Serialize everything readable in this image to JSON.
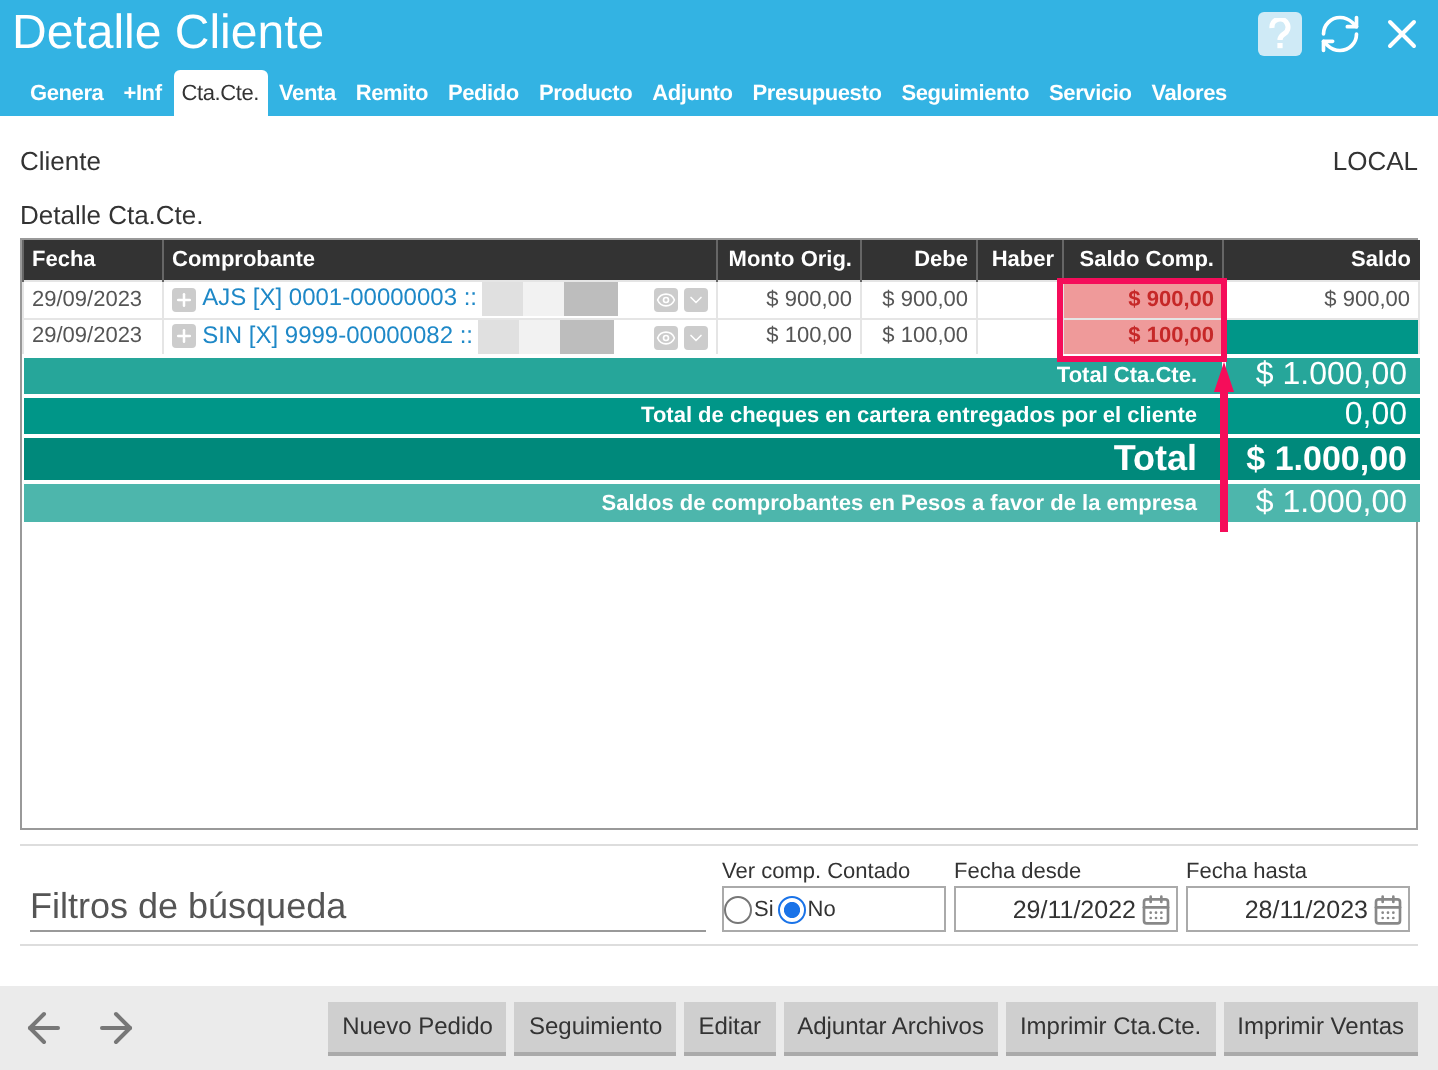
{
  "window": {
    "title": "Detalle Cliente"
  },
  "tabs": [
    {
      "label": "Genera",
      "selected": false
    },
    {
      "label": "+Inf",
      "selected": false
    },
    {
      "label": "Cta.Cte.",
      "selected": true
    },
    {
      "label": "Venta",
      "selected": false
    },
    {
      "label": "Remito",
      "selected": false
    },
    {
      "label": "Pedido",
      "selected": false
    },
    {
      "label": "Producto",
      "selected": false
    },
    {
      "label": "Adjunto",
      "selected": false
    },
    {
      "label": "Presupuesto",
      "selected": false
    },
    {
      "label": "Seguimiento",
      "selected": false
    },
    {
      "label": "Servicio",
      "selected": false
    },
    {
      "label": "Valores",
      "selected": false
    }
  ],
  "client": {
    "label": "Cliente",
    "value": "LOCAL"
  },
  "section_title": "Detalle Cta.Cte.",
  "table": {
    "columns": [
      "Fecha",
      "Comprobante",
      "Monto Orig.",
      "Debe",
      "Haber",
      "Saldo Comp.",
      "Saldo"
    ],
    "rows": [
      {
        "fecha": "29/09/2023",
        "comprobante": "AJS [X] 0001-00000003 ::",
        "monto": "$ 900,00",
        "debe": "$ 900,00",
        "haber": "",
        "saldo_comp": "$ 900,00",
        "saldo": "$ 900,00",
        "highlighted": true
      },
      {
        "fecha": "29/09/2023",
        "comprobante": "SIN [X] 9999-00000082 ::",
        "monto": "$ 100,00",
        "debe": "$ 100,00",
        "haber": "",
        "saldo_comp": "$ 100,00",
        "saldo": "",
        "highlighted": true
      }
    ],
    "summary": [
      {
        "kind": "subtotal",
        "label": "Total Cta.Cte.",
        "value": "$ 1.000,00"
      },
      {
        "kind": "cheques",
        "label": "Total de cheques en cartera entregados por el cliente",
        "value": "0,00"
      },
      {
        "kind": "total",
        "label": "Total",
        "value": "$ 1.000,00"
      },
      {
        "kind": "favor",
        "label": "Saldos de comprobantes en Pesos a favor de la empresa",
        "value": "$ 1.000,00"
      }
    ]
  },
  "filters": {
    "title": "Filtros de búsqueda",
    "contado": {
      "label": "Ver comp. Contado",
      "options": [
        {
          "label": "Si",
          "selected": false
        },
        {
          "label": "No",
          "selected": true
        }
      ]
    },
    "desde": {
      "label": "Fecha desde",
      "value": "29/11/2022"
    },
    "hasta": {
      "label": "Fecha hasta",
      "value": "28/11/2023"
    }
  },
  "buttons": [
    "Nuevo Pedido",
    "Seguimiento",
    "Editar",
    "Adjuntar Archivos",
    "Imprimir Cta.Cte.",
    "Imprimir Ventas"
  ]
}
